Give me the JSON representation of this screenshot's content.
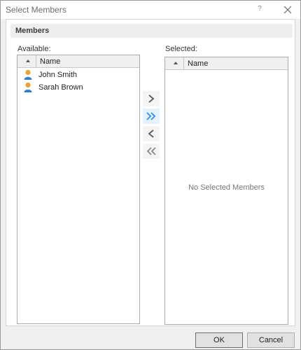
{
  "window": {
    "title": "Select Members",
    "help_label": "?"
  },
  "section": {
    "title": "Members"
  },
  "available": {
    "label": "Available:",
    "column_header": "Name",
    "items": [
      {
        "name": "John Smith",
        "icon": "user-icon"
      },
      {
        "name": "Sarah Brown",
        "icon": "user-icon"
      }
    ]
  },
  "selected": {
    "label": "Selected:",
    "column_header": "Name",
    "empty_message": "No Selected Members"
  },
  "buttons": {
    "ok": "OK",
    "cancel": "Cancel"
  },
  "colors": {
    "accent_blue": "#2f8de4",
    "user_head": "#f0a030",
    "user_body": "#2f7fcf"
  }
}
